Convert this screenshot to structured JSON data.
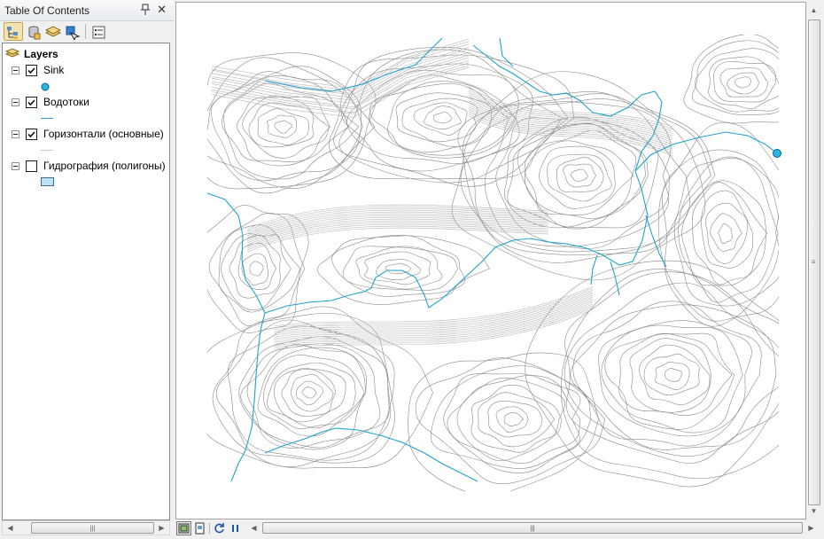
{
  "toc": {
    "title": "Table Of Contents",
    "pin_icon": "pin-icon",
    "close_icon": "close-icon",
    "toolbar": [
      {
        "name": "list-by-drawing-order-button",
        "icon": "list-drawing-order-icon",
        "active": true
      },
      {
        "name": "list-by-source-button",
        "icon": "database-icon",
        "active": false
      },
      {
        "name": "list-by-visibility-button",
        "icon": "layers-visibility-icon",
        "active": false
      },
      {
        "name": "list-by-selection-button",
        "icon": "selection-icon",
        "active": false
      },
      {
        "name": "options-button",
        "icon": "options-list-icon",
        "active": false
      }
    ],
    "data_frame": {
      "label": "Layers",
      "icon": "layers-icon"
    },
    "layers": [
      {
        "label": "Sink",
        "checked": true,
        "expanded": true,
        "symbol": "point",
        "symbol_color": "#29b6e5"
      },
      {
        "label": "Водотоки",
        "checked": true,
        "expanded": true,
        "symbol": "line",
        "symbol_color": "#2aa9d6"
      },
      {
        "label": "Горизонтали (основные)",
        "checked": true,
        "expanded": true,
        "symbol": "line",
        "symbol_color": "#c8c8c8"
      },
      {
        "label": "Гидрография (полигоны)",
        "checked": false,
        "expanded": true,
        "symbol": "polygon",
        "symbol_color": "#bfe3f3"
      }
    ]
  },
  "map": {
    "contour_color": "#8a8a8a",
    "stream_color": "#1fa3cf",
    "sink_color": "#29b6e5",
    "background": "#ffffff"
  },
  "map_bottom": {
    "buttons": [
      {
        "name": "layout-view-button",
        "icon": "layout-view-icon",
        "active": true
      },
      {
        "name": "data-view-button",
        "icon": "data-view-icon",
        "active": false
      },
      {
        "name": "refresh-button",
        "icon": "refresh-icon",
        "active": false
      },
      {
        "name": "pause-drawing-button",
        "icon": "pause-icon",
        "active": false
      }
    ]
  }
}
